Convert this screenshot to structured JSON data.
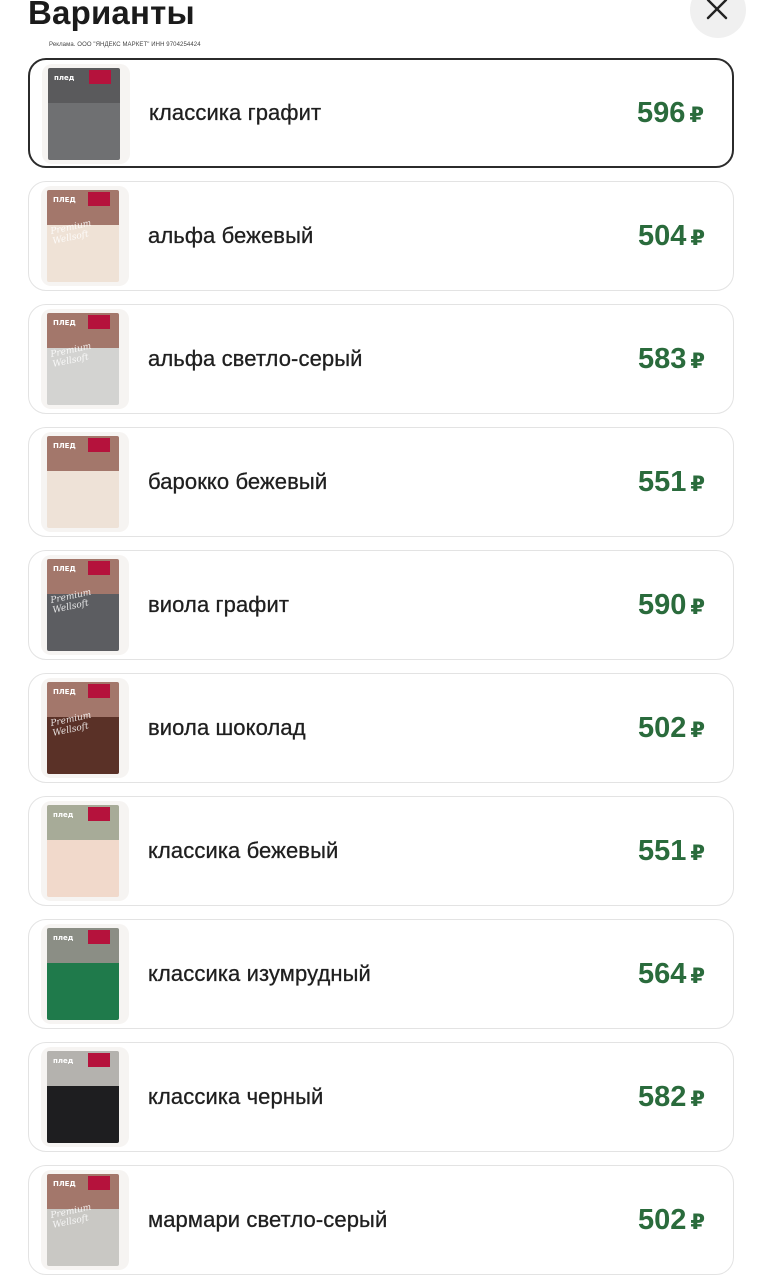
{
  "header": {
    "title": "Варианты",
    "ad_note": "Реклама. ООО \"ЯНДЕКС МАРКЕТ\" ИНН 9704254424"
  },
  "variants": [
    {
      "name": "классика графит",
      "price": "596",
      "currency": "₽",
      "selected": true,
      "thumb": {
        "wall": "#5a5a5c",
        "bed": "#6f7072",
        "label": "плед",
        "size": "150x200",
        "script": ""
      }
    },
    {
      "name": "альфа бежевый",
      "price": "504",
      "currency": "₽",
      "selected": false,
      "thumb": {
        "wall": "#a3776b",
        "bed": "#efe2d6",
        "label": "ПЛЕД",
        "size": "150x200",
        "script": "Premium Wellsoft"
      }
    },
    {
      "name": "альфа светло-серый",
      "price": "583",
      "currency": "₽",
      "selected": false,
      "thumb": {
        "wall": "#a3776b",
        "bed": "#d3d3d1",
        "label": "ПЛЕД",
        "size": "150x200",
        "script": "Premium Wellsoft"
      }
    },
    {
      "name": "барокко бежевый",
      "price": "551",
      "currency": "₽",
      "selected": false,
      "thumb": {
        "wall": "#a3776b",
        "bed": "#eee2d7",
        "label": "ПЛЕД",
        "size": "150x200",
        "script": ""
      }
    },
    {
      "name": "виола графит",
      "price": "590",
      "currency": "₽",
      "selected": false,
      "thumb": {
        "wall": "#a3776b",
        "bed": "#5c5d61",
        "label": "ПЛЕД",
        "size": "150x200",
        "script": "Premium Wellsoft"
      }
    },
    {
      "name": "виола шоколад",
      "price": "502",
      "currency": "₽",
      "selected": false,
      "thumb": {
        "wall": "#a3776b",
        "bed": "#5a3127",
        "label": "ПЛЕД",
        "size": "150x200",
        "script": "Premium Wellsoft"
      }
    },
    {
      "name": "классика бежевый",
      "price": "551",
      "currency": "₽",
      "selected": false,
      "thumb": {
        "wall": "#a7ab98",
        "bed": "#f1d9cb",
        "label": "плед",
        "size": "150x200",
        "script": ""
      }
    },
    {
      "name": "классика изумрудный",
      "price": "564",
      "currency": "₽",
      "selected": false,
      "thumb": {
        "wall": "#8b8e85",
        "bed": "#1f7a4b",
        "label": "плед",
        "size": "150x200",
        "script": ""
      }
    },
    {
      "name": "классика черный",
      "price": "582",
      "currency": "₽",
      "selected": false,
      "thumb": {
        "wall": "#b4b2ae",
        "bed": "#1e1e20",
        "label": "плед",
        "size": "150x200",
        "script": ""
      }
    },
    {
      "name": "мармари светло-серый",
      "price": "502",
      "currency": "₽",
      "selected": false,
      "thumb": {
        "wall": "#a3776b",
        "bed": "#c9c8c4",
        "label": "ПЛЕД",
        "size": "150x200",
        "script": "Premium Wellsoft"
      }
    }
  ],
  "colors": {
    "price": "#2a6b3c",
    "brand": "#b5123c",
    "selected_border": "#2b2b2b"
  },
  "icons": {
    "close": "close-icon"
  }
}
